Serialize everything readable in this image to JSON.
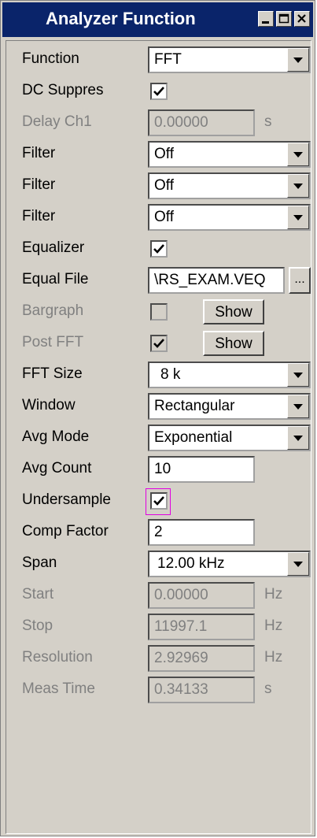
{
  "window": {
    "title": "Analyzer Function",
    "minimize_icon": "minimize-icon",
    "maximize_icon": "maximize-icon",
    "close_icon": "close-icon"
  },
  "rows": {
    "function": {
      "label": "Function",
      "value": "FFT"
    },
    "dc_suppress": {
      "label": "DC Suppres",
      "checked": true
    },
    "delay_ch1": {
      "label": "Delay Ch1",
      "value": "0.00000",
      "unit": "s"
    },
    "filter1": {
      "label": "Filter",
      "value": "Off"
    },
    "filter2": {
      "label": "Filter",
      "value": "Off"
    },
    "filter3": {
      "label": "Filter",
      "value": "Off"
    },
    "equalizer": {
      "label": "Equalizer",
      "checked": true
    },
    "equal_file": {
      "label": "Equal File",
      "value": "\\RS_EXAM.VEQ",
      "browse": "..."
    },
    "bargraph": {
      "label": "Bargraph",
      "checked": false,
      "button": "Show"
    },
    "post_fft": {
      "label": "Post FFT",
      "checked": true,
      "button": "Show"
    },
    "fft_size": {
      "label": "FFT Size",
      "value": "8 k"
    },
    "window": {
      "label": "Window",
      "value": "Rectangular"
    },
    "avg_mode": {
      "label": "Avg Mode",
      "value": "Exponential"
    },
    "avg_count": {
      "label": "Avg Count",
      "value": "10"
    },
    "undersample": {
      "label": "Undersample",
      "checked": true
    },
    "comp_factor": {
      "label": "Comp Factor",
      "value": "2"
    },
    "span": {
      "label": "Span",
      "value": "12.00 kHz"
    },
    "start": {
      "label": "Start",
      "value": "0.00000",
      "unit": "Hz"
    },
    "stop": {
      "label": "Stop",
      "value": "11997.1",
      "unit": "Hz"
    },
    "resolution": {
      "label": "Resolution",
      "value": "2.92969",
      "unit": "Hz"
    },
    "meas_time": {
      "label": "Meas Time",
      "value": "0.34133",
      "unit": "s"
    }
  },
  "colors": {
    "title_bar": "#0a246a",
    "face": "#d4d0c8",
    "focus": "#e100e1",
    "disabled_text": "#808080"
  }
}
